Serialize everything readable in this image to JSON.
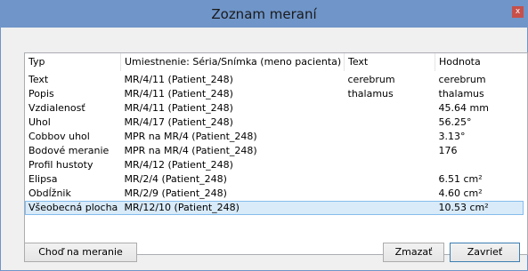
{
  "window": {
    "title": "Zoznam meraní",
    "close_label": "x"
  },
  "table": {
    "headers": [
      "Typ",
      "Umiestnenie: Séria/Snímka (meno pacienta)",
      "Text",
      "Hodnota"
    ],
    "rows": [
      [
        "Text",
        "MR/4/11  (Patient_248)",
        "cerebrum",
        "cerebrum"
      ],
      [
        "Popis",
        "MR/4/11  (Patient_248)",
        "thalamus",
        "thalamus"
      ],
      [
        "Vzdialenosť",
        "MR/4/11  (Patient_248)",
        "",
        "45.64 mm"
      ],
      [
        "Uhol",
        "MR/4/17  (Patient_248)",
        "",
        "56.25°"
      ],
      [
        "Cobbov uhol",
        "MPR na MR/4  (Patient_248)",
        "",
        "3.13°"
      ],
      [
        "Bodové meranie",
        "MPR na MR/4  (Patient_248)",
        "",
        "176"
      ],
      [
        "Profil hustoty",
        "MR/4/12  (Patient_248)",
        "",
        ""
      ],
      [
        "Elipsa",
        "MR/2/4  (Patient_248)",
        "",
        "6.51 cm²"
      ],
      [
        "Obdĺžnik",
        "MR/2/9  (Patient_248)",
        "",
        "4.60 cm²"
      ],
      [
        "Všeobecná plocha",
        "MR/12/10  (Patient_248)",
        "",
        "10.53 cm²"
      ]
    ],
    "selected_row": 9
  },
  "buttons": {
    "goto": "Choď na meranie",
    "delete": "Zmazať",
    "close": "Zavrieť"
  }
}
